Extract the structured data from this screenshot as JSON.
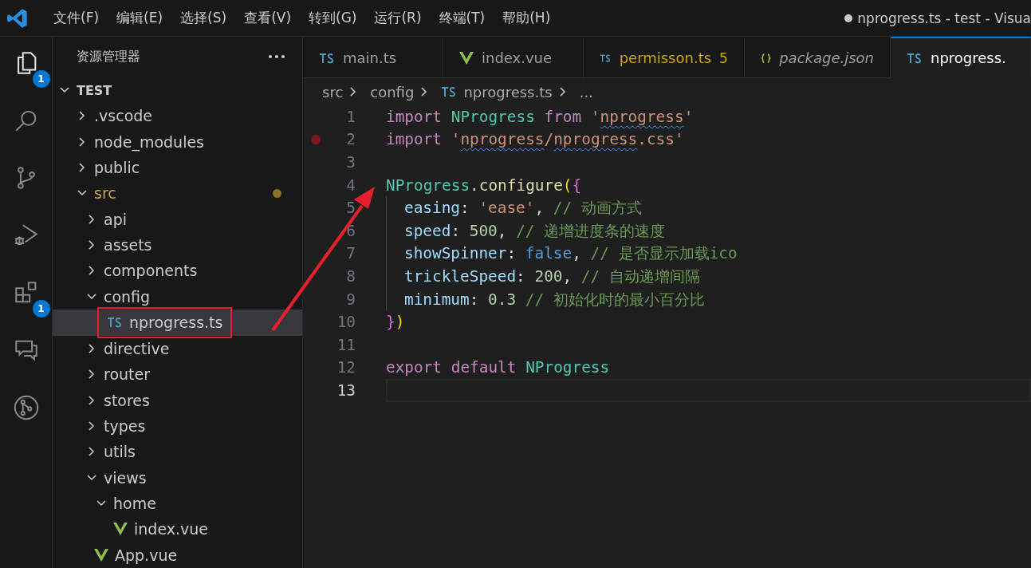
{
  "menu_bar": {
    "items": [
      "文件(F)",
      "编辑(E)",
      "选择(S)",
      "查看(V)",
      "转到(G)",
      "运行(R)",
      "终端(T)",
      "帮助(H)"
    ]
  },
  "window": {
    "title": "nprogress.ts - test - Visua",
    "dirty": true
  },
  "activity_bar": {
    "items": [
      {
        "kind": "files",
        "selected": true,
        "badge": "1"
      },
      {
        "kind": "search",
        "selected": false
      },
      {
        "kind": "source-control",
        "selected": false
      },
      {
        "kind": "debug",
        "selected": false
      },
      {
        "kind": "extensions",
        "selected": false,
        "badge": "1"
      },
      {
        "kind": "chat",
        "selected": false
      },
      {
        "kind": "git",
        "selected": false
      }
    ]
  },
  "explorer": {
    "title": "资源管理器",
    "root": {
      "label": "TEST",
      "expanded": true,
      "children": [
        {
          "label": ".vscode",
          "kind": "folder",
          "expanded": false
        },
        {
          "label": "node_modules",
          "kind": "folder",
          "expanded": false
        },
        {
          "label": "public",
          "kind": "folder",
          "expanded": false
        },
        {
          "label": "src",
          "kind": "folder",
          "expanded": true,
          "modified": true,
          "children": [
            {
              "label": "api",
              "kind": "folder",
              "expanded": false
            },
            {
              "label": "assets",
              "kind": "folder",
              "expanded": false
            },
            {
              "label": "components",
              "kind": "folder",
              "expanded": false
            },
            {
              "label": "config",
              "kind": "folder",
              "expanded": true,
              "children": [
                {
                  "label": "nprogress.ts",
                  "kind": "ts",
                  "selected": true,
                  "highlighted": true
                }
              ]
            },
            {
              "label": "directive",
              "kind": "folder",
              "expanded": false
            },
            {
              "label": "router",
              "kind": "folder",
              "expanded": false
            },
            {
              "label": "stores",
              "kind": "folder",
              "expanded": false
            },
            {
              "label": "types",
              "kind": "folder",
              "expanded": false
            },
            {
              "label": "utils",
              "kind": "folder",
              "expanded": false
            },
            {
              "label": "views",
              "kind": "folder",
              "expanded": true,
              "children": [
                {
                  "label": "home",
                  "kind": "folder",
                  "expanded": true,
                  "children": [
                    {
                      "label": "index.vue",
                      "kind": "vue",
                      "selected": false
                    }
                  ]
                }
              ]
            },
            {
              "label": "App.vue",
              "kind": "vue",
              "selected": false
            }
          ]
        }
      ]
    }
  },
  "tabs": [
    {
      "label": "main.ts",
      "kind": "ts",
      "selected": false
    },
    {
      "label": "index.vue",
      "kind": "vue",
      "selected": false
    },
    {
      "label": "permisson.ts",
      "kind": "ts",
      "selected": false,
      "warning": true,
      "problems": "5"
    },
    {
      "label": "package.json",
      "kind": "json",
      "selected": false,
      "preview": true
    },
    {
      "label": "nprogress.",
      "kind": "ts",
      "selected": true
    }
  ],
  "breadcrumb": [
    {
      "label": "src"
    },
    {
      "label": "config"
    },
    {
      "label": "nprogress.ts",
      "kind": "ts"
    },
    {
      "label": "..."
    }
  ],
  "editor": {
    "lines": [
      {
        "number": "1",
        "tokens": [
          {
            "text": "import ",
            "kind": "keyword"
          },
          {
            "text": "NProgress ",
            "kind": "type"
          },
          {
            "text": "from ",
            "kind": "keyword"
          },
          {
            "text": "'",
            "kind": "string"
          },
          {
            "text": "nprogress",
            "kind": "string",
            "error": true
          },
          {
            "text": "'",
            "kind": "string"
          }
        ]
      },
      {
        "number": "2",
        "breakpoint": true,
        "tokens": [
          {
            "text": "import ",
            "kind": "keyword"
          },
          {
            "text": "'",
            "kind": "string"
          },
          {
            "text": "nprogress",
            "kind": "string",
            "error": true
          },
          {
            "text": "/",
            "kind": "string"
          },
          {
            "text": "nprogress",
            "kind": "string",
            "error": true
          },
          {
            "text": ".css'",
            "kind": "string"
          }
        ]
      },
      {
        "number": "3"
      },
      {
        "number": "4",
        "tokens": [
          {
            "text": "NProgress",
            "kind": "type"
          },
          {
            "text": ".",
            "kind": "plain"
          },
          {
            "text": "configure",
            "kind": "function"
          },
          {
            "text": "(",
            "kind": "bracket1"
          },
          {
            "text": "{",
            "kind": "bracket2"
          }
        ]
      },
      {
        "number": "5",
        "indented": true,
        "tokens": [
          {
            "text": "easing",
            "kind": "property"
          },
          {
            "text": ": ",
            "kind": "plain"
          },
          {
            "text": "'ease'",
            "kind": "string"
          },
          {
            "text": ", ",
            "kind": "plain"
          },
          {
            "text": "// 动画方式",
            "kind": "comment"
          }
        ]
      },
      {
        "number": "6",
        "indented": true,
        "tokens": [
          {
            "text": "speed",
            "kind": "property"
          },
          {
            "text": ": ",
            "kind": "plain"
          },
          {
            "text": "500",
            "kind": "number"
          },
          {
            "text": ", ",
            "kind": "plain"
          },
          {
            "text": "// 递增进度条的速度",
            "kind": "comment"
          }
        ]
      },
      {
        "number": "7",
        "indented": true,
        "tokens": [
          {
            "text": "showSpinner",
            "kind": "property"
          },
          {
            "text": ": ",
            "kind": "plain"
          },
          {
            "text": "false",
            "kind": "boolean"
          },
          {
            "text": ", ",
            "kind": "plain"
          },
          {
            "text": "// 是否显示加载ico",
            "kind": "comment"
          }
        ]
      },
      {
        "number": "8",
        "indented": true,
        "tokens": [
          {
            "text": "trickleSpeed",
            "kind": "property"
          },
          {
            "text": ": ",
            "kind": "plain"
          },
          {
            "text": "200",
            "kind": "number"
          },
          {
            "text": ", ",
            "kind": "plain"
          },
          {
            "text": "// 自动递增间隔",
            "kind": "comment"
          }
        ]
      },
      {
        "number": "9",
        "indented": true,
        "tokens": [
          {
            "text": "minimum",
            "kind": "property"
          },
          {
            "text": ": ",
            "kind": "plain"
          },
          {
            "text": "0.3 ",
            "kind": "number"
          },
          {
            "text": "// 初始化时的最小百分比",
            "kind": "comment"
          }
        ]
      },
      {
        "number": "10",
        "tokens": [
          {
            "text": "}",
            "kind": "bracket2"
          },
          {
            "text": ")",
            "kind": "bracket1"
          }
        ]
      },
      {
        "number": "11"
      },
      {
        "number": "12",
        "tokens": [
          {
            "text": "export ",
            "kind": "keyword"
          },
          {
            "text": "default ",
            "kind": "keyword"
          },
          {
            "text": "NProgress",
            "kind": "type"
          }
        ]
      },
      {
        "number": "13",
        "current": true
      }
    ]
  }
}
